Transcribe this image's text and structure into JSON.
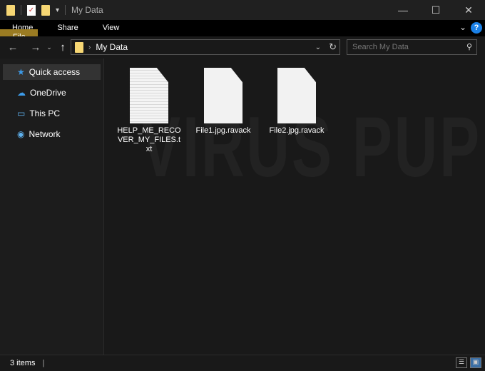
{
  "window": {
    "title": "My Data",
    "minimize": "—",
    "maximize": "☐",
    "close": "✕"
  },
  "ribbon": {
    "tabs": [
      "File",
      "Home",
      "Share",
      "View"
    ],
    "help": "?"
  },
  "address": {
    "path": "My Data",
    "search_placeholder": "Search My Data"
  },
  "sidebar": {
    "items": [
      {
        "label": "Quick access",
        "icon": "star-icon"
      },
      {
        "label": "OneDrive",
        "icon": "cloud-icon"
      },
      {
        "label": "This PC",
        "icon": "computer-icon"
      },
      {
        "label": "Network",
        "icon": "network-icon"
      }
    ]
  },
  "files": [
    {
      "name": "HELP_ME_RECOVER_MY_FILES.txt",
      "type": "text"
    },
    {
      "name": "File1.jpg.ravack",
      "type": "blank"
    },
    {
      "name": "File2.jpg.ravack",
      "type": "blank"
    }
  ],
  "watermark": "VIRUS PUP",
  "status": {
    "count": "3 items"
  },
  "colors": {
    "file_tab": "#9a7b22",
    "help": "#1a80e6"
  }
}
